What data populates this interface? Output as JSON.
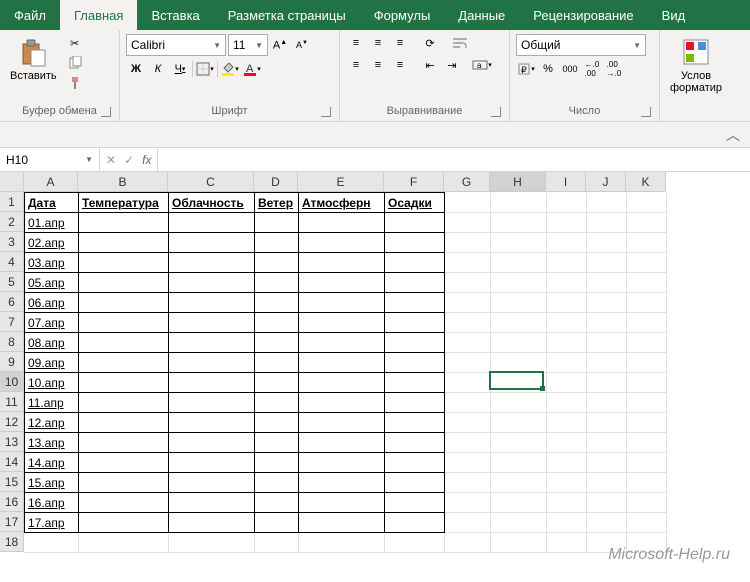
{
  "tabs": {
    "file": "Файл",
    "items": [
      "Главная",
      "Вставка",
      "Разметка страницы",
      "Формулы",
      "Данные",
      "Рецензирование",
      "Вид"
    ],
    "active_index": 0
  },
  "ribbon": {
    "clipboard": {
      "paste": "Вставить",
      "label": "Буфер обмена"
    },
    "font": {
      "name": "Calibri",
      "size": "11",
      "bold": "Ж",
      "italic": "К",
      "underline": "Ч",
      "label": "Шрифт"
    },
    "alignment": {
      "label": "Выравнивание"
    },
    "number": {
      "format": "Общий",
      "label": "Число"
    },
    "styles": {
      "cond": "Услов",
      "cond2": "форматир"
    }
  },
  "namebox": "H10",
  "formula": "",
  "columns": {
    "labels": [
      "A",
      "B",
      "C",
      "D",
      "E",
      "F",
      "G",
      "H",
      "I",
      "J",
      "K"
    ],
    "widths": [
      54,
      90,
      86,
      44,
      86,
      60,
      46,
      56,
      40,
      40,
      40
    ],
    "headers": [
      "Дата",
      "Температура",
      "Облачность",
      "Ветер",
      "Атмосферн",
      "Осадки"
    ]
  },
  "rows": {
    "count": 18,
    "dates": [
      "",
      "01.апр",
      "02.апр",
      "03.апр",
      "05.апр",
      "06.апр",
      "07.апр",
      "08.апр",
      "09.апр",
      "10.апр",
      "11.апр",
      "12.апр",
      "13.апр",
      "14.апр",
      "15.апр",
      "16.апр",
      "17.апр",
      ""
    ]
  },
  "active_cell": {
    "row": 10,
    "col": "H"
  },
  "watermark": "Microsoft-Help.ru"
}
